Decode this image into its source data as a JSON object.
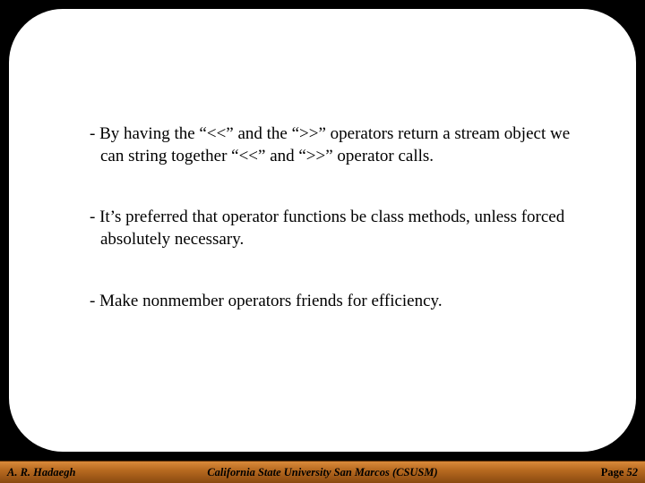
{
  "bullets": {
    "b1": "- By having the “<<” and the “>>” operators return a stream object we can string together “<<” and “>>” operator calls.",
    "b2": "- It’s preferred that operator functions be class methods, unless forced absolutely necessary.",
    "b3": "- Make nonmember operators friends for efficiency."
  },
  "footer": {
    "author": "A. R. Hadaegh",
    "institution": "California State University San Marcos (CSUSM)",
    "page_label": "Page",
    "page_number": "52"
  }
}
